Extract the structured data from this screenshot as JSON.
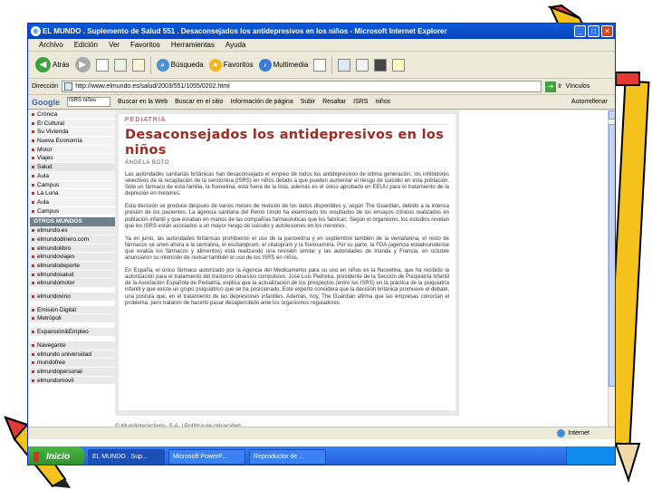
{
  "window": {
    "title": "EL MUNDO . Suplemento de Salud 551 . Desaconsejados los antidepresivos en los niños - Microsoft Internet Explorer"
  },
  "menu": [
    "Archivo",
    "Edición",
    "Ver",
    "Favoritos",
    "Herramientas",
    "Ayuda"
  ],
  "toolbar": {
    "back": "Atrás",
    "search": "Búsqueda",
    "favorites": "Favoritos",
    "multimedia": "Multimedia"
  },
  "address": {
    "label": "Dirección",
    "url": "http://www.elmundo.es/salud/2003/551/1055/0202.html",
    "go": "Ir",
    "links": "Vínculos"
  },
  "googlebar": {
    "logo": "Google",
    "query": "ISRS niños",
    "buttons": [
      "Buscar en la Web",
      "Buscar en el sitio",
      "Información de página",
      "Subir",
      "Resaltar",
      "ISRS",
      "niños"
    ],
    "autofill": "Autorrellenar"
  },
  "sidebar": {
    "items_top": [
      "Crónica",
      "El Cultural",
      "Su Vivienda",
      "Nueva Economía",
      "Motor",
      "Viajes",
      "Salud",
      "Aula",
      "Campus",
      "La Luna",
      "Aula",
      "Campus"
    ],
    "header": "OTROS MUNDOS",
    "items_bottom": [
      "elmundo.es",
      "elmundodinero.com",
      "elmundolibro",
      "elmundoviajes",
      "elmundodeporte",
      "elmundosalud",
      "elmundomotor",
      "elmundovino"
    ],
    "items_extra": [
      "Emisión Digital",
      "Metrópoli",
      "Expansión&Empleo",
      "Navegante",
      "elmundo universidad",
      "mundofree",
      "elmundopersonal",
      "elmundomovil"
    ]
  },
  "article": {
    "section": "PEDIATRÍA",
    "headline": "Desaconsejados los antidepresivos en los niños",
    "byline": "ÁNGELA BOTO",
    "paragraphs": [
      "Las autoridades sanitarias británicas han desaconsejado el empleo de todos los antidepresivos de última generación, los inhibidores selectivos de la recaptación de la serotonina (ISRS) en niños debido a que pueden aumentar el riesgo de suicidio en esta población. Sólo un fármaco de esta familia, la fluoxetina, está fuera de la lista, además es el único aprobado en EEUU para el tratamiento de la depresión en menores.",
      "Esta decisión se produce después de varios meses de revisión de los datos disponibles y, según The Guardian, debido a la intensa presión de los pacientes. La agencia sanitaria del Reino Unido ha examinado los resultados de los ensayos clínicos realizados en población infantil y que estaban en manos de las compañías farmacéuticas que los fabrican. Según el organismo, los estudios revelan que los ISRS están asociados a un mayor riesgo de suicidio y autolesiones en los menores.",
      "Ya en junio, las autoridades británicas prohibieron el uso de la paroxetina y en septiembre también de la venlafaxina, el resto de fármacos se unen ahora a la sertralina, el escitalopram, el citalopram y la fluvoxamina. Por su parte, la FDA (agencia estadounidense que evalúa los fármacos y alimentos) está realizando una revisión similar y las autoridades de Irlanda y Francia, en octubre anunciaron su intención de revisar también el uso de los ISRS en niños.",
      "En España, el único fármaco autorizado por la Agencia del Medicamento para su uso en niños es la fluoxetina, que ha recibido la autorización para el tratamiento del trastorno obsesivo compulsivo. José Luis Pedreira, presidente de la Sección de Psiquiatría Infantil de la Asociación Española de Pediatría, explica que la actualización de los prospectos (entre los ISRS) en la práctica de la psiquiatría infantil y que existe un grupo psiquiátrico que se ha posicionado. Este experto considera que la decisión británica promueve el debate, una postura que, en el tratamiento de las depresiones infantiles. Además, hoy, The Guardian afirma que las empresas conocían el problema, pero trataron de hacerlo pasar desapercibido ante los organismos reguladores."
    ],
    "footer": "© Mundinteractivos, S.A. | Política de privacidad"
  },
  "status": {
    "left": "",
    "zone": "Internet"
  },
  "taskbar": {
    "start": "Inicio",
    "items": [
      "EL MUNDO . Sup...",
      "Microsoft PowerP...",
      "Reproductor de ..."
    ],
    "clock": ""
  }
}
